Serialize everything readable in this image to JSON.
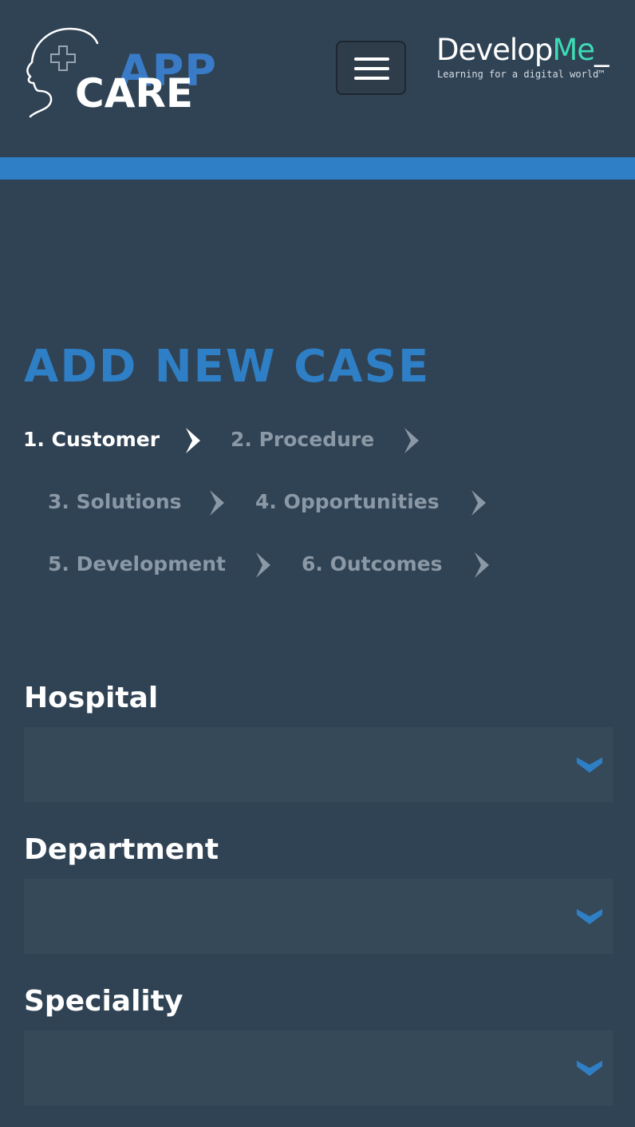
{
  "header": {
    "logo": {
      "word_top": "APP",
      "word_bottom": "CARE",
      "icon": "head-medical-cross-icon"
    },
    "menu_button": {
      "icon": "hamburger-menu-icon"
    },
    "brand": {
      "name_main": "Develop",
      "name_accent": "Me",
      "name_suffix": "_",
      "tagline": "Learning for a digital world™"
    }
  },
  "colors": {
    "background": "#304355",
    "accent_blue": "#2f7fc6",
    "brand_green": "#3ddbb6",
    "inactive_step": "#8b98a5",
    "field_background": "#364959"
  },
  "page": {
    "title": "ADD NEW CASE"
  },
  "steps": [
    {
      "label": "1. Customer",
      "active": true,
      "icon": "chevron-right-icon"
    },
    {
      "label": "2. Procedure",
      "active": false,
      "icon": "chevron-right-icon"
    },
    {
      "label": "3. Solutions",
      "active": false,
      "icon": "chevron-right-icon"
    },
    {
      "label": "4. Opportunities",
      "active": false,
      "icon": "chevron-right-icon"
    },
    {
      "label": "5. Development",
      "active": false,
      "icon": "chevron-right-icon"
    },
    {
      "label": "6. Outcomes",
      "active": false,
      "icon": "chevron-right-icon"
    }
  ],
  "form": {
    "fields": [
      {
        "label": "Hospital",
        "value": "",
        "icon": "chevron-down-icon"
      },
      {
        "label": "Department",
        "value": "",
        "icon": "chevron-down-icon"
      },
      {
        "label": "Speciality",
        "value": "",
        "icon": "chevron-down-icon"
      }
    ]
  }
}
